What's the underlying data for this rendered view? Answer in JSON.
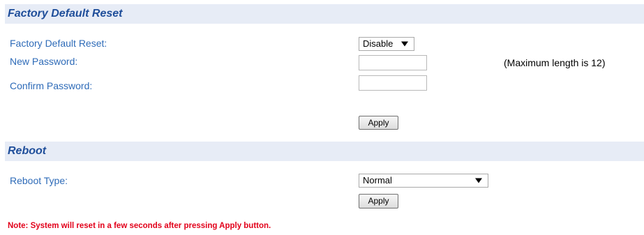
{
  "factory_section": {
    "title": "Factory Default Reset",
    "reset_label": "Factory Default Reset:",
    "reset_value": "Disable",
    "new_password_label": "New Password:",
    "new_password_value": "",
    "confirm_password_label": "Confirm Password:",
    "confirm_password_value": "",
    "max_length_hint": "(Maximum length is 12)",
    "apply_label": "Apply"
  },
  "reboot_section": {
    "title": "Reboot",
    "type_label": "Reboot Type:",
    "type_value": "Normal",
    "apply_label": "Apply"
  },
  "note": "Note: System will reset in a few seconds after pressing Apply button."
}
